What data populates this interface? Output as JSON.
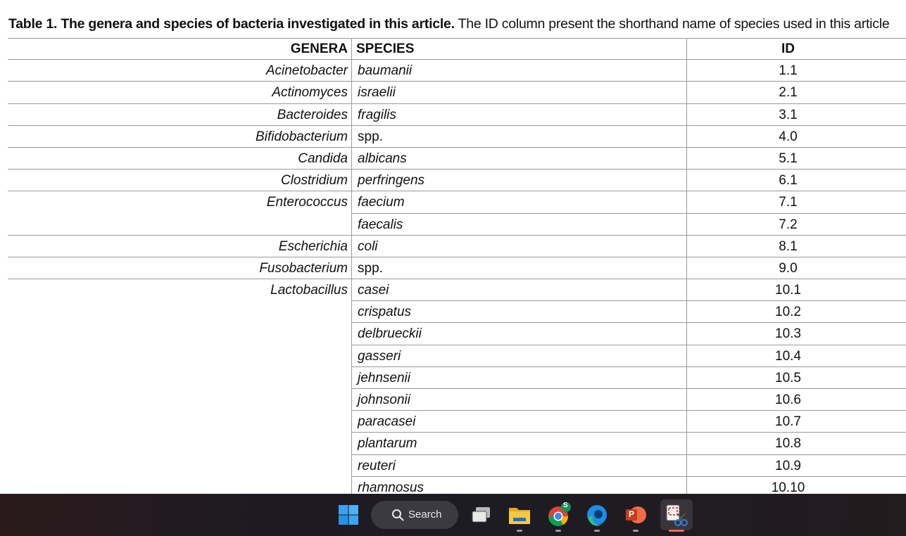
{
  "caption": {
    "bold": "Table 1. The genera and species of bacteria investigated in this article.",
    "rest": " The ID column present the shorthand name of species used in this article"
  },
  "table": {
    "headers": {
      "genera": "GENERA",
      "species": "SPECIES",
      "id": "ID"
    },
    "rows": [
      {
        "genus": "Acinetobacter",
        "species": "baumanii",
        "id": "1.1"
      },
      {
        "genus": "Actinomyces",
        "species": "israelii",
        "id": "2.1"
      },
      {
        "genus": "Bacteroides",
        "species": "fragilis",
        "id": "3.1"
      },
      {
        "genus": "Bifidobacterium",
        "species": "spp.",
        "id": "4.0"
      },
      {
        "genus": "Candida",
        "species": "albicans",
        "id": "5.1"
      },
      {
        "genus": "Clostridium",
        "species": "perfringens",
        "id": "6.1"
      },
      {
        "genus": "Enterococcus",
        "species": "faecium",
        "id": "7.1"
      },
      {
        "genus": "",
        "species": "faecalis",
        "id": "7.2"
      },
      {
        "genus": "Escherichia",
        "species": "coli",
        "id": "8.1"
      },
      {
        "genus": "Fusobacterium",
        "species": "spp.",
        "id": "9.0"
      },
      {
        "genus": "Lactobacillus",
        "species": "casei",
        "id": "10.1"
      },
      {
        "genus": "",
        "species": "crispatus",
        "id": "10.2"
      },
      {
        "genus": "",
        "species": "delbrueckii",
        "id": "10.3"
      },
      {
        "genus": "",
        "species": "gasseri",
        "id": "10.4"
      },
      {
        "genus": "",
        "species": "jehnsenii",
        "id": "10.5"
      },
      {
        "genus": "",
        "species": "johnsonii",
        "id": "10.6"
      },
      {
        "genus": "",
        "species": "paracasei",
        "id": "10.7"
      },
      {
        "genus": "",
        "species": "plantarum",
        "id": "10.8"
      },
      {
        "genus": "",
        "species": "reuteri",
        "id": "10.9"
      },
      {
        "genus": "",
        "species": "rhamnosus",
        "id": "10.10"
      }
    ]
  },
  "taskbar": {
    "search_label": "Search",
    "chrome_badge": "S",
    "ppt_letter": "P",
    "colors": {
      "active_indicator": "#f06a5a",
      "start_blue": "#2f9bf0"
    }
  }
}
